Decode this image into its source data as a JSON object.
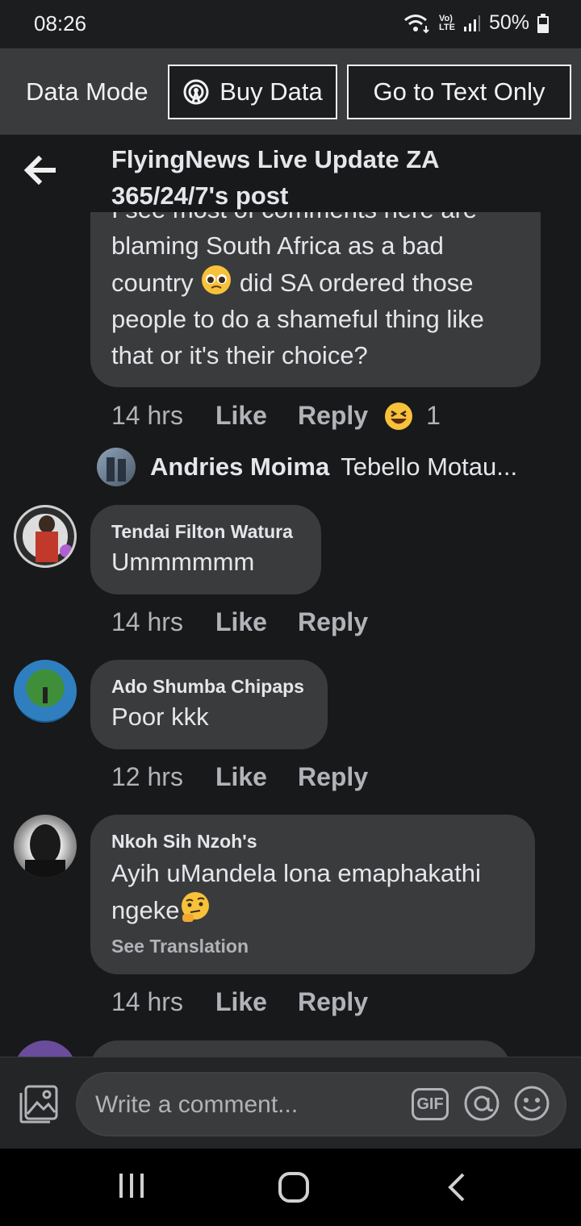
{
  "status": {
    "time": "08:26",
    "battery": "50%",
    "lte_label": "LTE",
    "volte_label": "Vo)"
  },
  "data_bar": {
    "label": "Data Mode",
    "buy_data": "Buy Data",
    "text_only": "Go to Text Only"
  },
  "header": {
    "title": "FlyingNews Live Update ZA 365/24/7's post"
  },
  "comments": [
    {
      "partial_top": "I see most of comments here are",
      "text_part1": "blaming South Africa as a bad country",
      "text_part2": "did SA ordered those people to do a shameful thing like that or it's their choice?",
      "time": "14 hrs",
      "like": "Like",
      "reply": "Reply",
      "reaction_count": "1"
    }
  ],
  "reply_preview": {
    "name": "Andries Moima",
    "text": "Tebello Motau..."
  },
  "comment_tendai": {
    "name": "Tendai Filton Watura",
    "text": "Ummmmmm",
    "time": "14 hrs",
    "like": "Like",
    "reply": "Reply"
  },
  "comment_ado": {
    "name": "Ado Shumba Chipaps",
    "text": "Poor kkk",
    "time": "12 hrs",
    "like": "Like",
    "reply": "Reply"
  },
  "comment_nkoh": {
    "name": "Nkoh Sih Nzoh's",
    "text_line1": "Ayih uMandela lona emaphakathi",
    "text_line2": "ngeke",
    "see_translation": "See Translation",
    "time": "14 hrs",
    "like": "Like",
    "reply": "Reply"
  },
  "composer": {
    "placeholder": "Write a comment...",
    "gif": "GIF"
  },
  "colors": {
    "background": "#18191a",
    "bubble": "#3a3b3c",
    "secondary_text": "#b0b3b8",
    "data_bar": "#3a3b3c"
  }
}
